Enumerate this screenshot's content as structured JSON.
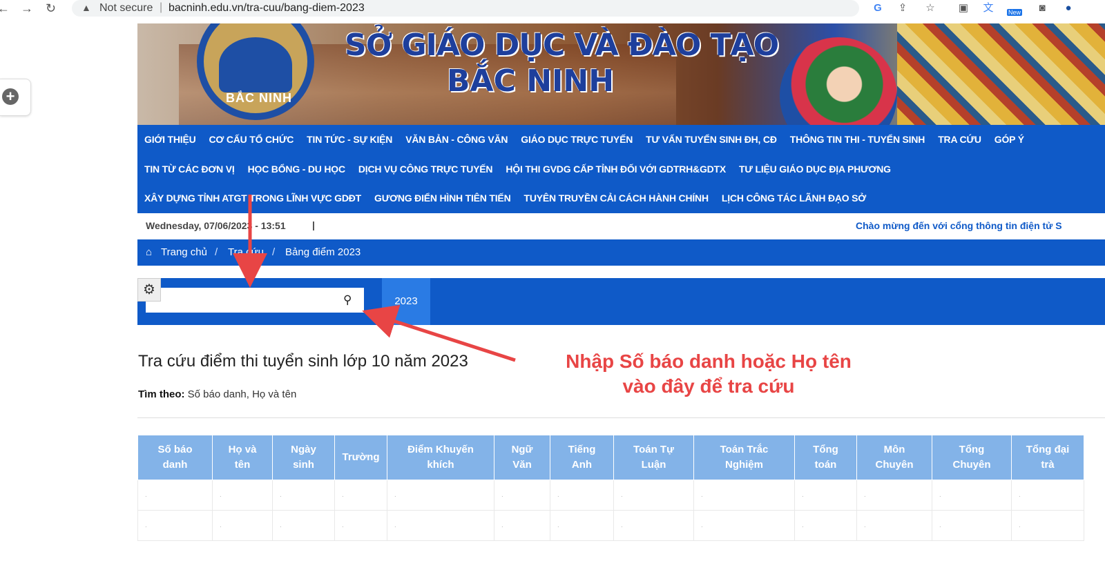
{
  "browser": {
    "security_label": "Not secure",
    "url": "bacninh.edu.vn/tra-cuu/bang-diem-2023",
    "new_badge": "New"
  },
  "banner": {
    "title_line1": "SỞ GIÁO DỤC VÀ ĐÀO TẠO",
    "title_line2": "BẮC NINH",
    "logo_text": "BẮC NINH"
  },
  "nav": {
    "row1": [
      "GIỚI THIỆU",
      "CƠ CẤU TỔ CHỨC",
      "TIN TỨC - SỰ KIỆN",
      "VĂN BẢN - CÔNG VĂN",
      "GIÁO DỤC TRỰC TUYẾN",
      "TƯ VẤN TUYỂN SINH ĐH, CĐ",
      "THÔNG TIN THI - TUYỂN SINH",
      "TRA CỨU",
      "GÓP Ý"
    ],
    "row2": [
      "TIN TỪ CÁC ĐƠN VỊ",
      "HỌC BỔNG - DU HỌC",
      "DỊCH VỤ CÔNG TRỰC TUYẾN",
      "HỘI THI GVDG CẤP TỈNH ĐỐI VỚI GDTRH&GDTX",
      "TƯ LIỆU GIÁO DỤC ĐỊA PHƯƠNG"
    ],
    "row3": [
      "XÂY DỰNG TỈNH ATGT TRONG LĨNH VỰC GDĐT",
      "GƯƠNG ĐIỂN HÌNH TIÊN TIẾN",
      "TUYÊN TRUYỀN CẢI CÁCH HÀNH CHÍNH",
      "LỊCH CÔNG TÁC LÃNH ĐẠO SỞ"
    ]
  },
  "date_bar": {
    "date": "Wednesday, 07/06/2023 - 13:51",
    "separator": "|",
    "marquee": "Chào mừng đến với cổng thông tin điện tử S"
  },
  "breadcrumb": {
    "home": "Trang chủ",
    "level2": "Tra cứu",
    "current": "Bảng điểm 2023",
    "sep": "/"
  },
  "search": {
    "value": "",
    "placeholder": "",
    "year_tab": "2023"
  },
  "content": {
    "title": "Tra cứu điểm thi tuyển sinh lớp 10 năm 2023",
    "search_by_label": "Tìm theo:",
    "search_by_value": "Số báo danh, Họ và tên"
  },
  "annotation": {
    "line1": "Nhập Số báo danh hoặc Họ tên",
    "line2": "vào đây để tra cứu",
    "color": "#e84545"
  },
  "table": {
    "columns": [
      [
        "Số báo",
        "danh"
      ],
      [
        "Họ và",
        "tên"
      ],
      [
        "Ngày",
        "sinh"
      ],
      [
        "Trường",
        ""
      ],
      [
        "Điểm Khuyến",
        "khích"
      ],
      [
        "Ngữ",
        "Văn"
      ],
      [
        "Tiếng",
        "Anh"
      ],
      [
        "Toán Tự",
        "Luận"
      ],
      [
        "Toán Trắc",
        "Nghiệm"
      ],
      [
        "Tổng",
        "toán"
      ],
      [
        "Môn",
        "Chuyên"
      ],
      [
        "Tổng",
        "Chuyên"
      ],
      [
        "Tổng đại",
        "trà"
      ]
    ],
    "rows": [
      [
        ".",
        ".",
        ".",
        ".",
        ".",
        ".",
        ".",
        ".",
        ".",
        ".",
        ".",
        ".",
        "."
      ],
      [
        ".",
        ".",
        ".",
        ".",
        ".",
        ".",
        ".",
        ".",
        ".",
        ".",
        ".",
        ".",
        "."
      ]
    ]
  },
  "colors": {
    "nav_blue": "#0f5ac8",
    "header_cell": "#83b3e8",
    "arrow_red": "#e84545"
  }
}
